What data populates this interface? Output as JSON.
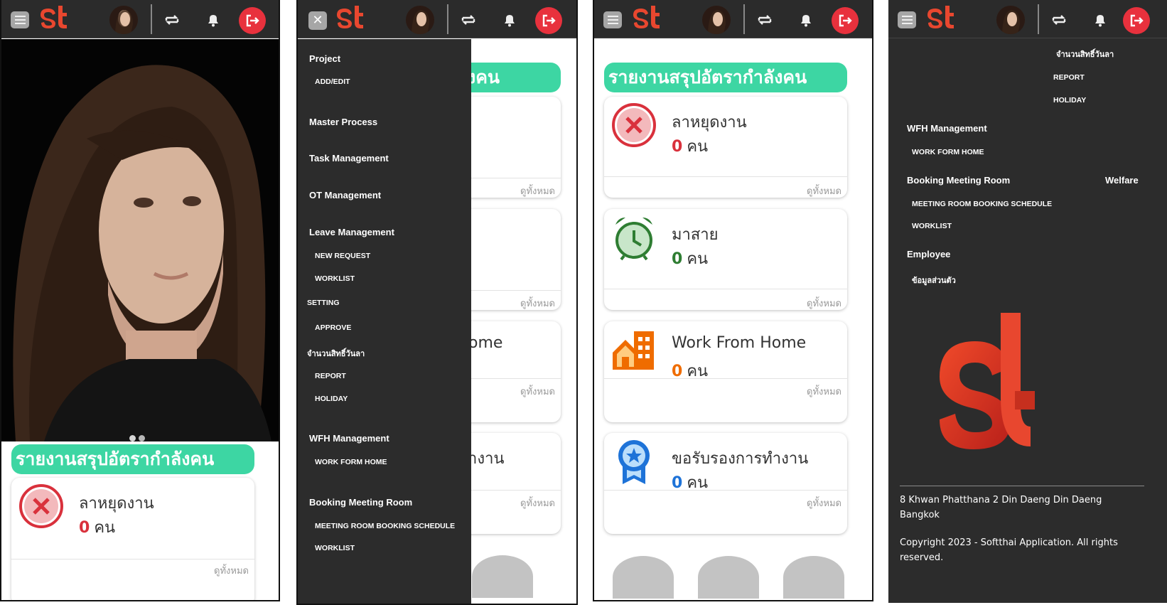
{
  "header": {
    "logo_text": "st",
    "close_symbol": "✕",
    "icons": [
      "menu-icon",
      "switch-icon",
      "bell-icon",
      "logout-icon"
    ]
  },
  "carousel": {
    "slides": 2,
    "active": 1
  },
  "summary": {
    "title": "รายงานสรุปอัตรากำลังคน",
    "title_cut": "ังคน"
  },
  "cards": [
    {
      "title": "ลาหยุดงาน",
      "count": "0",
      "unit": "คน",
      "link": "ดูทั้งหมด",
      "color": "#d9313c",
      "icon": "x-circle-icon"
    },
    {
      "title": "มาสาย",
      "count": "0",
      "unit": "คน",
      "link": "ดูทั้งหมด",
      "color": "#2e7d32",
      "icon": "alarm-clock-icon"
    },
    {
      "title": "Work From Home",
      "count": "0",
      "unit": "คน",
      "link": "ดูทั้งหมด",
      "color": "#ef6c00",
      "icon": "home-building-icon"
    },
    {
      "title": "ขอรับรองการทำงาน",
      "count": "0",
      "unit": "คน",
      "link": "ดูทั้งหมด",
      "color": "#1e73d8",
      "icon": "award-icon"
    }
  ],
  "cut_titles": {
    "wfh": "ome",
    "certify": "ำงาน"
  },
  "menu": {
    "project": "Project",
    "add_edit": "ADD/EDIT",
    "master_process": "Master Process",
    "task_management": "Task Management",
    "ot_management": "OT Management",
    "leave_management": "Leave Management",
    "new_request": "NEW REQUEST",
    "worklist": "WORKLIST",
    "setting": "SETTING",
    "approve": "APPROVE",
    "leave_quota": "จำนวนสิทธิ์วันลา",
    "report": "REPORT",
    "holiday": "HOLIDAY",
    "wfh_management": "WFH Management",
    "work_form_home": "WORK FORM HOME",
    "booking_meeting_room": "Booking Meeting Room",
    "meeting_room_booking_schedule": "MEETING ROOM BOOKING SCHEDULE",
    "welfare": "Welfare",
    "employee": "Employee",
    "personal_info": "ข้อมูลส่วนตัว"
  },
  "footer": {
    "address": "8 Khwan Phatthana 2 Din Daeng Din Daeng Bangkok",
    "copyright": "Copyright 2023 - Softthai Application. All rights reserved."
  },
  "colors": {
    "brand": "#e8472f",
    "logout": "#e8313d",
    "summary": "#3dd6a3",
    "dark": "#2c2c2c"
  }
}
